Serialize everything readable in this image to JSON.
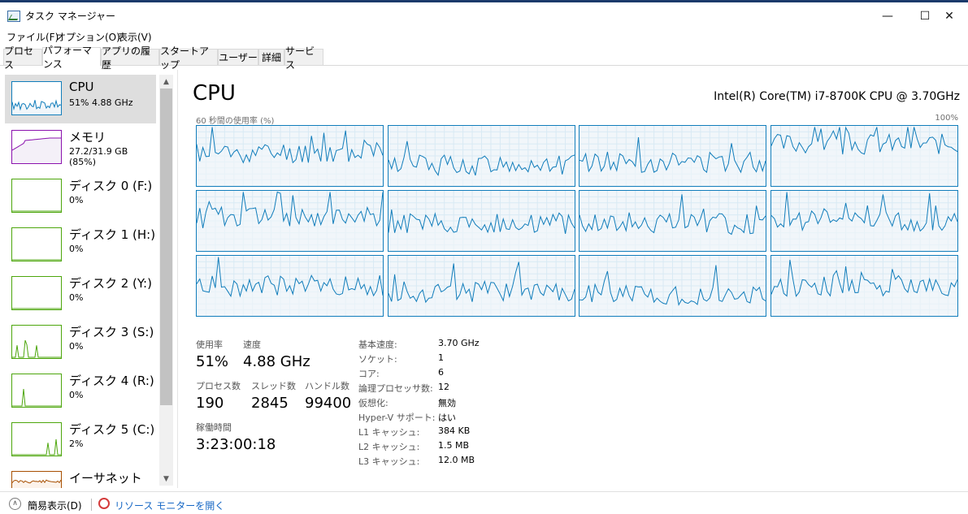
{
  "window": {
    "title": "タスク マネージャー",
    "min": "—",
    "max": "☐",
    "close": "✕"
  },
  "menu": [
    "ファイル(F)",
    "オプション(O)",
    "表示(V)"
  ],
  "tabs": [
    "プロセス",
    "パフォーマンス",
    "アプリの履歴",
    "スタートアップ",
    "ユーザー",
    "詳細",
    "サービス"
  ],
  "active_tab": 1,
  "sidebar": {
    "items": [
      {
        "name": "CPU",
        "sub": "51%  4.88 GHz",
        "color": "#117dbb",
        "kind": "cpu"
      },
      {
        "name": "メモリ",
        "sub": "27.2/31.9 GB (85%)",
        "color": "#8b12ae",
        "kind": "memory"
      },
      {
        "name": "ディスク 0 (F:)",
        "sub": "0%",
        "color": "#4da60c",
        "kind": "disk-empty"
      },
      {
        "name": "ディスク 1 (H:)",
        "sub": "0%",
        "color": "#4da60c",
        "kind": "disk-empty"
      },
      {
        "name": "ディスク 2 (Y:)",
        "sub": "0%",
        "color": "#4da60c",
        "kind": "disk-empty"
      },
      {
        "name": "ディスク 3 (S:)",
        "sub": "0%",
        "color": "#4da60c",
        "kind": "disk-spikes"
      },
      {
        "name": "ディスク 4 (R:)",
        "sub": "0%",
        "color": "#4da60c",
        "kind": "disk-one"
      },
      {
        "name": "ディスク 5 (C:)",
        "sub": "2%",
        "color": "#4da60c",
        "kind": "disk-two"
      },
      {
        "name": "イーサネット",
        "sub": "",
        "color": "#a74f01",
        "kind": "ethernet"
      }
    ]
  },
  "cpu_panel": {
    "heading": "CPU",
    "model": "Intel(R) Core(TM) i7-8700K CPU @ 3.70GHz",
    "graph_label": "60 秒間の使用率 (%)",
    "graph_max": "100%",
    "logical_graphs": 12
  },
  "stats": {
    "usage_label": "使用率",
    "usage": "51%",
    "speed_label": "速度",
    "speed": "4.88 GHz",
    "processes_label": "プロセス数",
    "processes": "190",
    "threads_label": "スレッド数",
    "threads": "2845",
    "handles_label": "ハンドル数",
    "handles": "99400",
    "uptime_label": "稼働時間",
    "uptime": "3:23:00:18"
  },
  "specs": [
    {
      "label": "基本速度:",
      "value": "3.70 GHz"
    },
    {
      "label": "ソケット:",
      "value": "1"
    },
    {
      "label": "コア:",
      "value": "6"
    },
    {
      "label": "論理プロセッサ数:",
      "value": "12"
    },
    {
      "label": "仮想化:",
      "value": "無効"
    },
    {
      "label": "Hyper-V サポート:",
      "value": "はい"
    },
    {
      "label": "L1 キャッシュ:",
      "value": "384 KB"
    },
    {
      "label": "L2 キャッシュ:",
      "value": "1.5 MB"
    },
    {
      "label": "L3 キャッシュ:",
      "value": "12.0 MB"
    }
  ],
  "footer": {
    "fewer_details": "簡易表示(D)",
    "resource_monitor": "リソース モニターを開く"
  },
  "icons": {
    "app": "task-manager-icon",
    "fewer": "chevron-up-circle-icon",
    "resmon": "resource-monitor-icon",
    "scroll_up": "scroll-up-arrow-icon",
    "scroll_down": "scroll-down-arrow-icon"
  }
}
